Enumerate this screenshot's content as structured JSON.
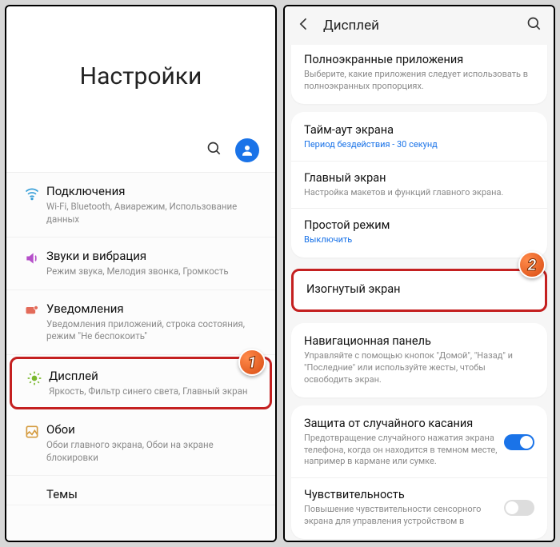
{
  "left": {
    "title": "Настройки",
    "items": [
      {
        "title": "Подключения",
        "sub": "Wi-Fi, Bluetooth, Авиарежим, Использование данных"
      },
      {
        "title": "Звуки и вибрация",
        "sub": "Режим звука, Мелодия звонка, Громкость"
      },
      {
        "title": "Уведомления",
        "sub": "Уведомления приложений, строка состояния, режим \"Не беспокоить\""
      },
      {
        "title": "Дисплей",
        "sub": "Яркость, Фильтр синего света, Главный экран"
      },
      {
        "title": "Обои",
        "sub": "Обои главного экрана, Обои на экране блокировки"
      },
      {
        "title": "Темы",
        "sub": ""
      }
    ],
    "badge": "1"
  },
  "right": {
    "header": "Дисплей",
    "group1": [
      {
        "title": "Полноэкранные приложения",
        "sub": "Выберите, какие приложения следует использовать в полноэкранных пропорциях."
      }
    ],
    "group2": [
      {
        "title": "Тайм-аут экрана",
        "sub": "Период бездействия - 30 секунд",
        "blue": true
      },
      {
        "title": "Главный экран",
        "sub": "Настройка макетов и функций главного экрана."
      },
      {
        "title": "Простой режим",
        "sub": "Выключить",
        "blue": true
      }
    ],
    "highlight": {
      "title": "Изогнутый экран"
    },
    "group3": [
      {
        "title": "Навигационная панель",
        "sub": "Управляйте с помощью кнопок \"Домой\", \"Назад\" и \"Последние\" или используйте жесты, чтобы освободить экран."
      }
    ],
    "group4": [
      {
        "title": "Защита от случайного касания",
        "sub": "Предотвращение случайного нажатия экрана телефона, когда он находится в темном месте, например в кармане или сумке.",
        "toggle": "on"
      },
      {
        "title": "Чувствительность",
        "sub": "Повышение чувствительности сенсорного экрана для управления устройством в",
        "toggle": "off"
      }
    ],
    "badge": "2"
  }
}
